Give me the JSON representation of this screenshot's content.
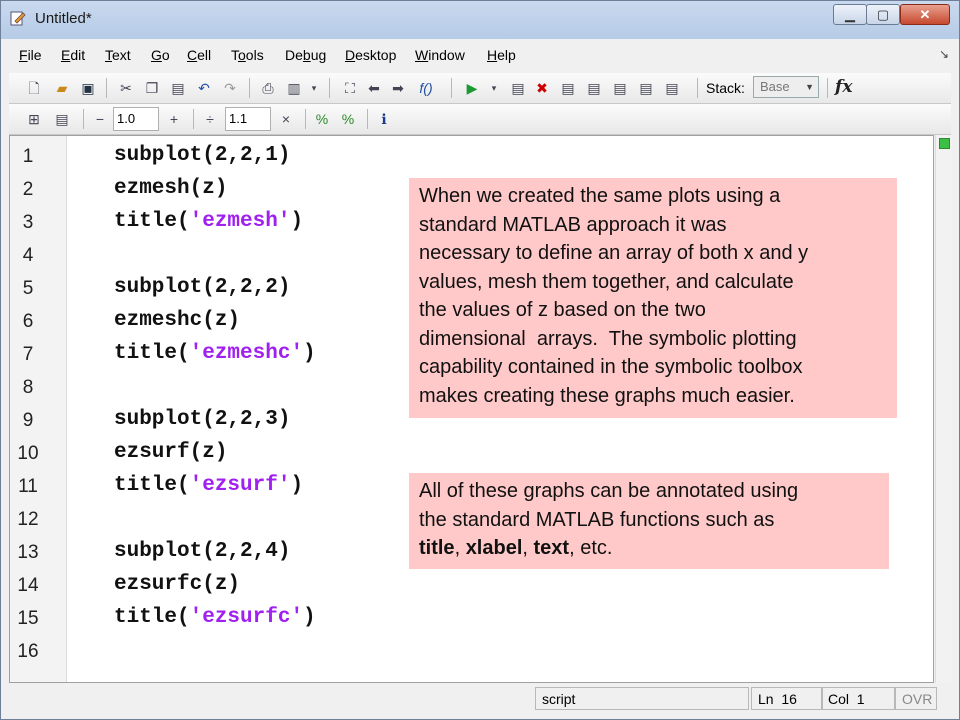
{
  "window": {
    "title": "Untitled*"
  },
  "menu": [
    {
      "label": "File",
      "u": "F",
      "rest": "ile"
    },
    {
      "label": "Edit",
      "u": "E",
      "rest": "dit"
    },
    {
      "label": "Text",
      "u": "T",
      "rest": "ext"
    },
    {
      "label": "Go",
      "u": "G",
      "rest": "o"
    },
    {
      "label": "Cell",
      "u": "C",
      "rest": "ell"
    },
    {
      "label": "Tools",
      "pre": "T",
      "u": "o",
      "rest": "ols"
    },
    {
      "label": "Debug",
      "pre": "De",
      "u": "b",
      "rest": "ug"
    },
    {
      "label": "Desktop",
      "u": "D",
      "rest": "esktop"
    },
    {
      "label": "Window",
      "u": "W",
      "rest": "indow"
    },
    {
      "label": "Help",
      "u": "H",
      "rest": "elp"
    }
  ],
  "toolbar": {
    "stack_label": "Stack:",
    "stack_value": "Base",
    "fx_label": "fx"
  },
  "cell_toolbar": {
    "minus": "−",
    "decrement_value": "1.0",
    "plus": "+",
    "divide": "÷",
    "scale_value": "1.1",
    "times": "×"
  },
  "editor": {
    "lines": [
      {
        "n": "1",
        "pre": "subplot(2,2,1)",
        "str": "",
        "post": ""
      },
      {
        "n": "2",
        "pre": "ezmesh(z)",
        "str": "",
        "post": ""
      },
      {
        "n": "3",
        "pre": "title(",
        "str": "'ezmesh'",
        "post": ")"
      },
      {
        "n": "4",
        "pre": "",
        "str": "",
        "post": ""
      },
      {
        "n": "5",
        "pre": "subplot(2,2,2)",
        "str": "",
        "post": ""
      },
      {
        "n": "6",
        "pre": "ezmeshc(z)",
        "str": "",
        "post": ""
      },
      {
        "n": "7",
        "pre": "title(",
        "str": "'ezmeshc'",
        "post": ")"
      },
      {
        "n": "8",
        "pre": "",
        "str": "",
        "post": ""
      },
      {
        "n": "9",
        "pre": "subplot(2,2,3)",
        "str": "",
        "post": ""
      },
      {
        "n": "10",
        "pre": "ezsurf(z)",
        "str": "",
        "post": ""
      },
      {
        "n": "11",
        "pre": "title(",
        "str": "'ezsurf'",
        "post": ")"
      },
      {
        "n": "12",
        "pre": "",
        "str": "",
        "post": ""
      },
      {
        "n": "13",
        "pre": "subplot(2,2,4)",
        "str": "",
        "post": ""
      },
      {
        "n": "14",
        "pre": "ezsurfc(z)",
        "str": "",
        "post": ""
      },
      {
        "n": "15",
        "pre": "title(",
        "str": "'ezsurfc'",
        "post": ")"
      },
      {
        "n": "16",
        "pre": "",
        "str": "",
        "post": ""
      }
    ],
    "string_color": "#a020f0"
  },
  "annotation1": {
    "lines": [
      "When we created the same plots using a",
      "standard MATLAB approach it was",
      "necessary to define an array of both x and y",
      "values, mesh them together, and calculate",
      "the values of z based on the two",
      "dimensional  arrays.  The symbolic plotting",
      "capability contained in the symbolic toolbox",
      "makes creating these graphs much easier."
    ]
  },
  "annotation2": {
    "line1": "All of these graphs can be annotated using",
    "line2": "the standard MATLAB functions such as",
    "f1": "title",
    "c1": ", ",
    "f2": "xlabel",
    "c2": ", ",
    "f3": "text",
    "tail": ", etc."
  },
  "status": {
    "type": "script",
    "ln_label": "Ln",
    "ln_value": "16",
    "col_label": "Col",
    "col_value": "1",
    "ovr": "OVR"
  },
  "colors": {
    "annotation_bg": "#ffc9c9",
    "editor_bg": "#ffffff"
  }
}
